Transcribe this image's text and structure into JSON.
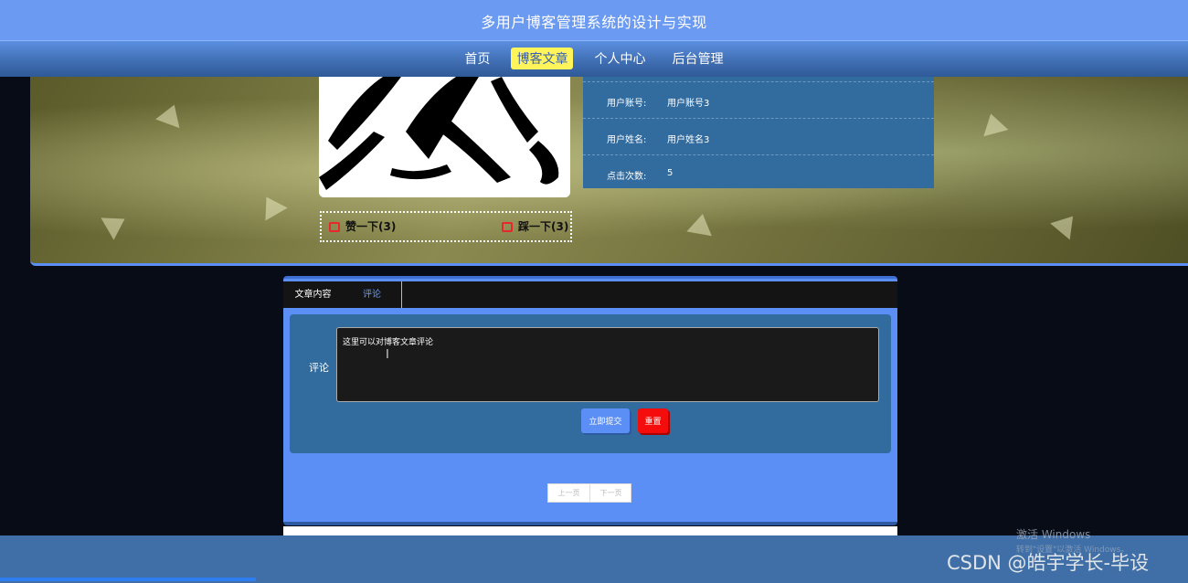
{
  "site": {
    "title": "多用户博客管理系统的设计与实现"
  },
  "nav": {
    "items": [
      {
        "label": "首页"
      },
      {
        "label": "博客文章"
      },
      {
        "label": "个人中心"
      },
      {
        "label": "后台管理"
      }
    ],
    "active_index": 1
  },
  "article_info": {
    "rows": [
      {
        "key": "用户账号:",
        "value": "用户账号3"
      },
      {
        "key": "用户姓名:",
        "value": "用户姓名3"
      },
      {
        "key": "点击次数:",
        "value": "5"
      }
    ]
  },
  "votes": {
    "like_label": "赞一下(3)",
    "dislike_label": "踩一下(3)"
  },
  "tabs": [
    {
      "label": "文章内容"
    },
    {
      "label": "评论"
    }
  ],
  "comment_form": {
    "label": "评论",
    "value": "这里可以对博客文章评论",
    "submit_label": "立即提交",
    "reset_label": "重置"
  },
  "pagination": {
    "prev_label": "上一页",
    "next_label": "下一页"
  },
  "watermarks": {
    "activate": "激活 Windows",
    "activate_hint": "转到\"设置\"以激活 Windows。",
    "csdn": "CSDN @皓宇学长-毕设"
  },
  "colors": {
    "accent": "#5b8ff5",
    "panel": "#326b9e",
    "active_nav": "#fff45a",
    "reset": "#f50d0d",
    "like_icon": "#e8262b"
  }
}
